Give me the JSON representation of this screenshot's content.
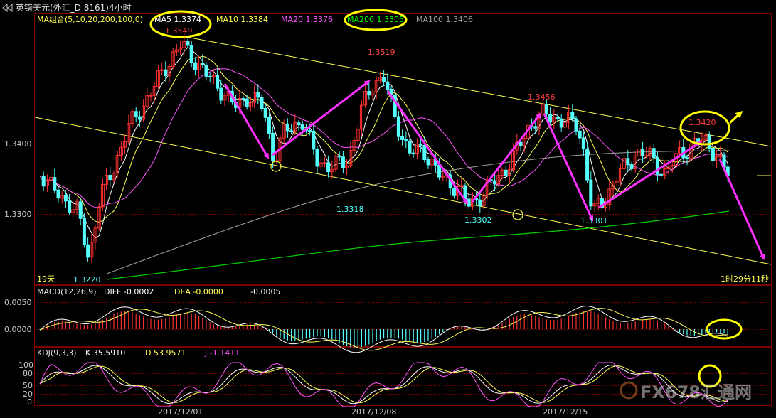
{
  "window": {
    "title": "英镑美元(外汇_D 8161)4小时",
    "title_icon": "back-arrow-icon"
  },
  "colors": {
    "background": "#000000",
    "candle_up": "#ff3030",
    "candle_down": "#54ffff",
    "ma5": "#ffffff",
    "ma10": "#ffff54",
    "ma20": "#ff54ff",
    "ma100": "#a0a0a0",
    "ma200": "#00d000",
    "channel": "#ffff54",
    "annotation_arrow": "#ff30ff",
    "annotation_circle": "#ffff00",
    "axis_text": "#c8c8c8"
  },
  "legend": {
    "ma_group": "MA组合(5,10,20,200,100,0)",
    "ma5": "MA5 1.3374",
    "ma10": "MA10 1.3384",
    "ma20": "MA20 1.3376",
    "ma200": "MA200 1.3305",
    "ma100": "MA100 1.3406"
  },
  "price_panel": {
    "y_ticks": [
      "1.3400",
      "1.3300"
    ],
    "left_note": "19天",
    "right_note": "1时29分11秒"
  },
  "price_labels": {
    "p1": "1.3549",
    "p2": "1.3519",
    "p3": "1.3456",
    "p4": "1.3420",
    "p5": "1.3220",
    "p6": "1.3318",
    "p7": "1.3302",
    "p8": "1.3301"
  },
  "macd_panel": {
    "title": "MACD(12,26,9)",
    "diff": "DIFF  -0.0002",
    "dea": "DEA  -0.0000",
    "macd": "-0.0005",
    "y_ticks": [
      "0.0050",
      "0.0000"
    ]
  },
  "kdj_panel": {
    "title": "KDJ(9,3,3)",
    "k": "K  35.5910",
    "d": "D  53.9571",
    "j": "J  -1.1411",
    "y_ticks": [
      "100",
      "80",
      "50",
      "20",
      "0"
    ]
  },
  "x_axis": {
    "ticks": [
      "2017/12/01",
      "2017/12/08",
      "2017/12/15"
    ]
  },
  "watermark": "FX678汇通网",
  "chart_data": {
    "type": "candlestick",
    "instrument": "英镑美元",
    "timeframe": "4小时",
    "price_axis_ticks": [
      1.34,
      1.33
    ],
    "annotated_prices": [
      1.3549,
      1.3519,
      1.3456,
      1.342,
      1.322,
      1.3318,
      1.3302,
      1.3301
    ],
    "moving_averages": [
      {
        "name": "MA5",
        "value": 1.3374
      },
      {
        "name": "MA10",
        "value": 1.3384
      },
      {
        "name": "MA20",
        "value": 1.3376
      },
      {
        "name": "MA200",
        "value": 1.3305
      },
      {
        "name": "MA100",
        "value": 1.3406
      }
    ],
    "macd": {
      "params": "12,26,9",
      "diff": -0.0002,
      "dea": -0.0,
      "macd": -0.0005,
      "ticks": [
        0.005,
        0.0
      ]
    },
    "kdj": {
      "params": "9,3,3",
      "k": 35.591,
      "d": 53.9571,
      "j": -1.1411,
      "ticks": [
        100,
        80,
        50,
        20,
        0
      ]
    },
    "x_labels": [
      "2017/12/01",
      "2017/12/08",
      "2017/12/15"
    ]
  }
}
